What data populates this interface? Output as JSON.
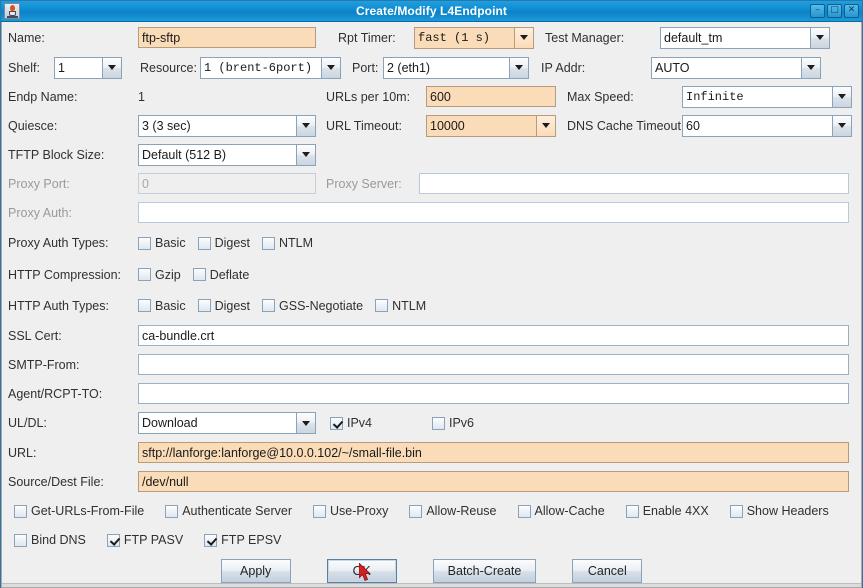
{
  "window": {
    "title": "Create/Modify L4Endpoint",
    "icon": "java-cup-icon",
    "buttons": {
      "minimize": "–",
      "maximize": "□",
      "close": "✕"
    }
  },
  "form": {
    "name": {
      "label": "Name:",
      "value": "ftp-sftp"
    },
    "rpt_timer": {
      "label": "Rpt Timer:",
      "value": "fast    (1 s)"
    },
    "test_manager": {
      "label": "Test Manager:",
      "value": "default_tm"
    },
    "shelf": {
      "label": "Shelf:",
      "value": "1"
    },
    "resource": {
      "label": "Resource:",
      "value": "1 (brent-6port)"
    },
    "port": {
      "label": "Port:",
      "value": "2 (eth1)"
    },
    "ip_addr": {
      "label": "IP Addr:",
      "value": "AUTO"
    },
    "endp_name": {
      "label": "Endp Name:",
      "value": "1"
    },
    "urls_per_10m": {
      "label": "URLs per 10m:",
      "value": "600"
    },
    "max_speed": {
      "label": "Max Speed:",
      "value": "Infinite"
    },
    "quiesce": {
      "label": "Quiesce:",
      "value": "3 (3 sec)"
    },
    "url_timeout": {
      "label": "URL Timeout:",
      "value": "10000"
    },
    "dns_cache_timeout": {
      "label": "DNS Cache Timeout:",
      "value": "60"
    },
    "tftp_block_size": {
      "label": "TFTP Block Size:",
      "value": "Default (512 B)"
    },
    "proxy_port": {
      "label": "Proxy Port:",
      "value": "0"
    },
    "proxy_server": {
      "label": "Proxy Server:",
      "value": ""
    },
    "proxy_auth": {
      "label": "Proxy Auth:",
      "value": ""
    },
    "proxy_auth_types": {
      "label": "Proxy Auth Types:",
      "options": [
        {
          "label": "Basic",
          "checked": false
        },
        {
          "label": "Digest",
          "checked": false
        },
        {
          "label": "NTLM",
          "checked": false
        }
      ]
    },
    "http_compression": {
      "label": "HTTP Compression:",
      "options": [
        {
          "label": "Gzip",
          "checked": false
        },
        {
          "label": "Deflate",
          "checked": false
        }
      ]
    },
    "http_auth_types": {
      "label": "HTTP Auth Types:",
      "options": [
        {
          "label": "Basic",
          "checked": false
        },
        {
          "label": "Digest",
          "checked": false
        },
        {
          "label": "GSS-Negotiate",
          "checked": false
        },
        {
          "label": "NTLM",
          "checked": false
        }
      ]
    },
    "ssl_cert": {
      "label": "SSL Cert:",
      "value": "ca-bundle.crt"
    },
    "smtp_from": {
      "label": "SMTP-From:",
      "value": ""
    },
    "agent_rcpt_to": {
      "label": "Agent/RCPT-TO:",
      "value": ""
    },
    "ul_dl": {
      "label": "UL/DL:",
      "value": "Download",
      "ipv4": {
        "label": "IPv4",
        "checked": true
      },
      "ipv6": {
        "label": "IPv6",
        "checked": false
      }
    },
    "url": {
      "label": "URL:",
      "value": "sftp://lanforge:lanforge@10.0.0.102/~/small-file.bin"
    },
    "source_dest_file": {
      "label": "Source/Dest File:",
      "value": "/dev/null"
    },
    "flags_row1": [
      {
        "label": "Get-URLs-From-File",
        "checked": false
      },
      {
        "label": "Authenticate Server",
        "checked": false
      },
      {
        "label": "Use-Proxy",
        "checked": false
      },
      {
        "label": "Allow-Reuse",
        "checked": false
      },
      {
        "label": "Allow-Cache",
        "checked": false
      },
      {
        "label": "Enable 4XX",
        "checked": false
      },
      {
        "label": "Show Headers",
        "checked": false
      }
    ],
    "flags_row2": [
      {
        "label": "Bind DNS",
        "checked": false
      },
      {
        "label": "FTP PASV",
        "checked": true
      },
      {
        "label": "FTP EPSV",
        "checked": true
      }
    ]
  },
  "actions": {
    "apply": "Apply",
    "ok": "OK",
    "batch_create": "Batch-Create",
    "cancel": "Cancel"
  },
  "colors": {
    "titlebar": "#0f8bd0",
    "background": "#efefef",
    "highlight_field": "#fbdcb9",
    "cursor": "#d32020"
  }
}
